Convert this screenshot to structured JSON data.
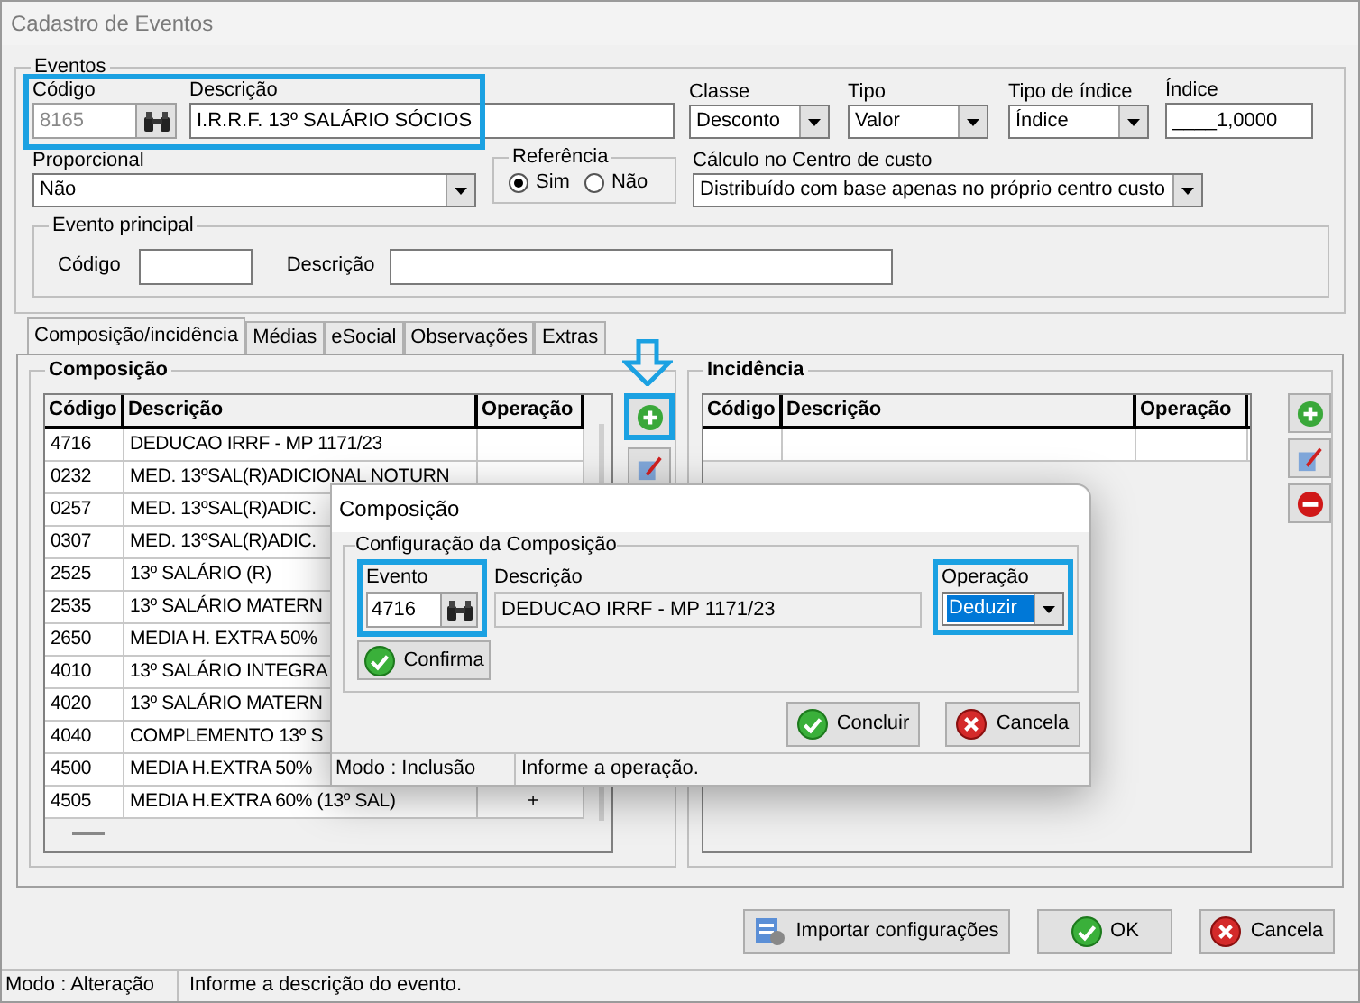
{
  "window": {
    "title": "Cadastro de Eventos"
  },
  "eventos": {
    "title": "Eventos",
    "highlighted": true,
    "codigo": {
      "label": "Código",
      "value": "8165",
      "disabled": true
    },
    "descricao": {
      "label": "Descrição",
      "value": "I.R.R.F. 13º SALÁRIO SÓCIOS"
    },
    "classe": {
      "label": "Classe",
      "value": "Desconto"
    },
    "tipo": {
      "label": "Tipo",
      "value": "Valor"
    },
    "tipo_indice": {
      "label": "Tipo de índice",
      "value": "Índice"
    },
    "indice": {
      "label": "Índice",
      "value": "____1,0000"
    },
    "proporcional": {
      "label": "Proporcional",
      "value": "Não"
    },
    "referencia": {
      "title": "Referência",
      "options": [
        {
          "label": "Sim",
          "selected": true
        },
        {
          "label": "Não",
          "selected": false
        }
      ]
    },
    "calculo": {
      "label": "Cálculo no Centro de custo",
      "value": "Distribuído com base apenas no próprio centro custo"
    },
    "evento_principal": {
      "title": "Evento principal",
      "codigo_label": "Código",
      "descricao_label": "Descrição"
    }
  },
  "tabs": [
    {
      "label": "Composição/incidência",
      "selected": true
    },
    {
      "label": "Médias",
      "selected": false
    },
    {
      "label": "eSocial",
      "selected": false
    },
    {
      "label": "Observações",
      "selected": false
    },
    {
      "label": "Extras",
      "selected": false
    }
  ],
  "composicao": {
    "title": "Composição",
    "add_highlighted": true,
    "pointer_arrow": true,
    "columns": [
      "Código",
      "Descrição",
      "Operação"
    ],
    "rows": [
      {
        "codigo": "4716",
        "descricao": "DEDUCAO IRRF - MP 1171/23",
        "operacao": ""
      },
      {
        "codigo": "0232",
        "descricao": "MED. 13ºSAL(R)ADICIONAL NOTURN",
        "operacao": ""
      },
      {
        "codigo": "0257",
        "descricao": "MED. 13ºSAL(R)ADIC.",
        "operacao": ""
      },
      {
        "codigo": "0307",
        "descricao": "MED. 13ºSAL(R)ADIC.",
        "operacao": ""
      },
      {
        "codigo": "2525",
        "descricao": "13º SALÁRIO (R)",
        "operacao": ""
      },
      {
        "codigo": "2535",
        "descricao": "13º SALÁRIO MATERN",
        "operacao": ""
      },
      {
        "codigo": "2650",
        "descricao": "MEDIA H. EXTRA 50%",
        "operacao": ""
      },
      {
        "codigo": "4010",
        "descricao": "13º SALÁRIO INTEGRA",
        "operacao": ""
      },
      {
        "codigo": "4020",
        "descricao": "13º SALÁRIO MATERN",
        "operacao": ""
      },
      {
        "codigo": "4040",
        "descricao": "COMPLEMENTO 13º S",
        "operacao": ""
      },
      {
        "codigo": "4500",
        "descricao": "MEDIA H.EXTRA 50%",
        "operacao": ""
      },
      {
        "codigo": "4505",
        "descricao": "MEDIA H.EXTRA 60% (13º SAL)",
        "operacao": "+"
      }
    ]
  },
  "incidencia": {
    "title": "Incidência",
    "columns": [
      "Código",
      "Descrição",
      "Operação"
    ]
  },
  "dialog": {
    "title": "Composição",
    "group_title": "Configuração da Composição",
    "evento": {
      "label": "Evento",
      "value": "4716",
      "highlighted": true
    },
    "descricao": {
      "label": "Descrição",
      "value": "DEDUCAO IRRF - MP 1171/23"
    },
    "operacao": {
      "label": "Operação",
      "value": "Deduzir",
      "highlighted": true,
      "focused": true
    },
    "confirma": "Confirma",
    "concluir": "Concluir",
    "cancela": "Cancela",
    "status": {
      "mode": "Modo : Inclusão",
      "message": "Informe a operação."
    }
  },
  "buttons": {
    "importar": "Importar configurações",
    "ok": "OK",
    "cancela": "Cancela"
  },
  "status_bar": {
    "mode": "Modo : Alteração",
    "message": "Informe a descrição do evento."
  }
}
